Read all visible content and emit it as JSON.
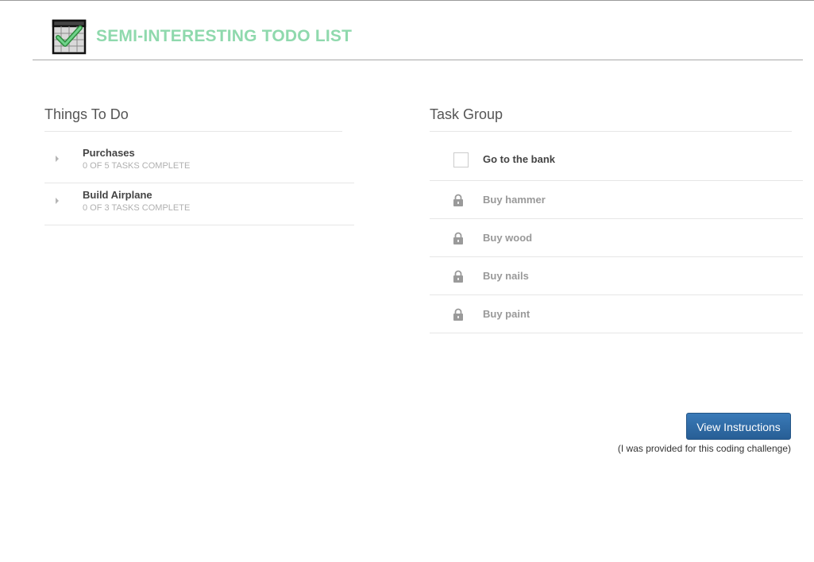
{
  "header": {
    "logo_icon": "checklist-calendar-icon",
    "title": "SEMI-INTERESTING TODO LIST",
    "title_color": "#8fd9ad"
  },
  "left_panel": {
    "title": "Things To Do",
    "groups": [
      {
        "name": "Purchases",
        "progress": "0 OF 5 TASKS COMPLETE",
        "icon": "caret-right-icon"
      },
      {
        "name": "Build Airplane",
        "progress": "0 OF 3 TASKS COMPLETE",
        "icon": "caret-right-icon"
      }
    ]
  },
  "right_panel": {
    "title": "Task Group",
    "tasks": [
      {
        "label": "Go to the bank",
        "state": "unchecked",
        "icon": "checkbox-icon"
      },
      {
        "label": "Buy hammer",
        "state": "locked",
        "icon": "lock-icon"
      },
      {
        "label": "Buy wood",
        "state": "locked",
        "icon": "lock-icon"
      },
      {
        "label": "Buy nails",
        "state": "locked",
        "icon": "lock-icon"
      },
      {
        "label": "Buy paint",
        "state": "locked",
        "icon": "lock-icon"
      }
    ]
  },
  "instructions": {
    "button_label": "View Instructions",
    "note": "(I was provided for this coding challenge)",
    "button_color": "#2d6aa6"
  }
}
